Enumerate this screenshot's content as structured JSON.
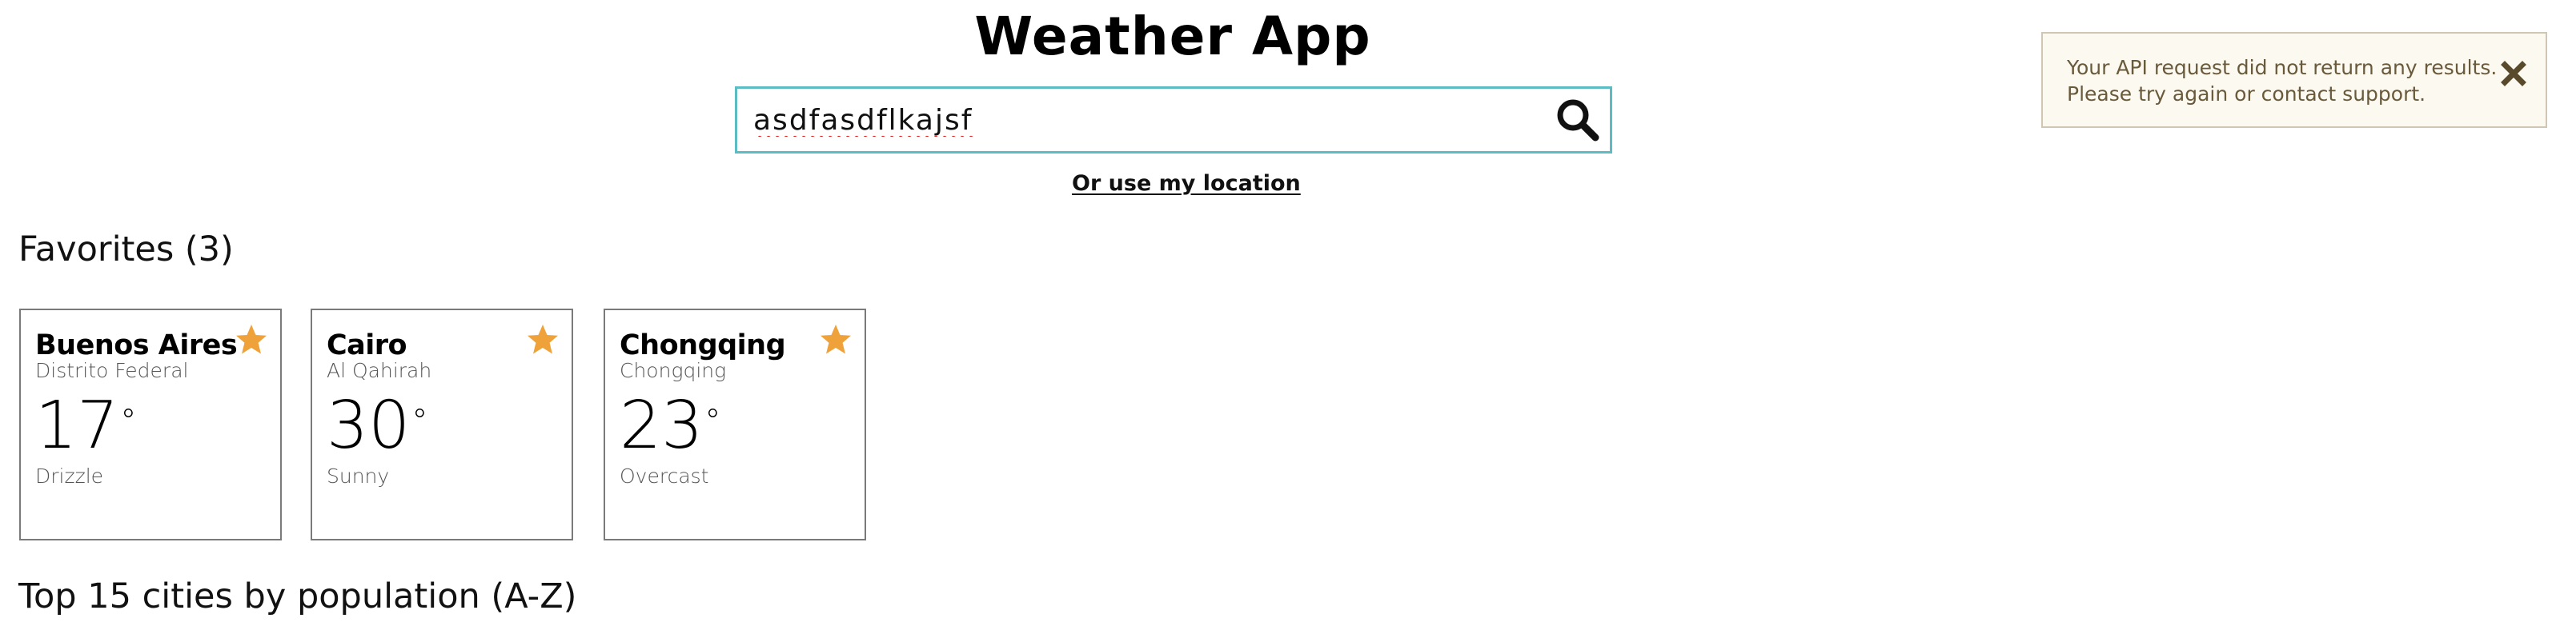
{
  "app": {
    "title": "Weather App"
  },
  "search": {
    "value": "asdfasdflkajsf",
    "button_icon": "search-icon"
  },
  "location_link": "Or use my location",
  "toast": {
    "message_line1": "Your API request did not return any results.",
    "message_line2": "Please try again or contact support.",
    "close_icon": "close-icon"
  },
  "favorites": {
    "heading": "Favorites (3)",
    "cards": [
      {
        "city": "Buenos Aires",
        "region": "Distrito Federal",
        "temp": "17",
        "condition": "Drizzle",
        "favorited": true
      },
      {
        "city": "Cairo",
        "region": "Al Qahirah",
        "temp": "30",
        "condition": "Sunny",
        "favorited": true
      },
      {
        "city": "Chongqing",
        "region": "Chongqing",
        "temp": "23",
        "condition": "Overcast",
        "favorited": true
      }
    ]
  },
  "top_cities": {
    "heading": "Top 15 cities by population (A-Z)"
  },
  "colors": {
    "search_border": "#5bbcc4",
    "star": "#f0a23a",
    "toast_background": "#fcf9f1",
    "toast_text": "#6a5a3c",
    "card_border": "#7a7a7a"
  }
}
